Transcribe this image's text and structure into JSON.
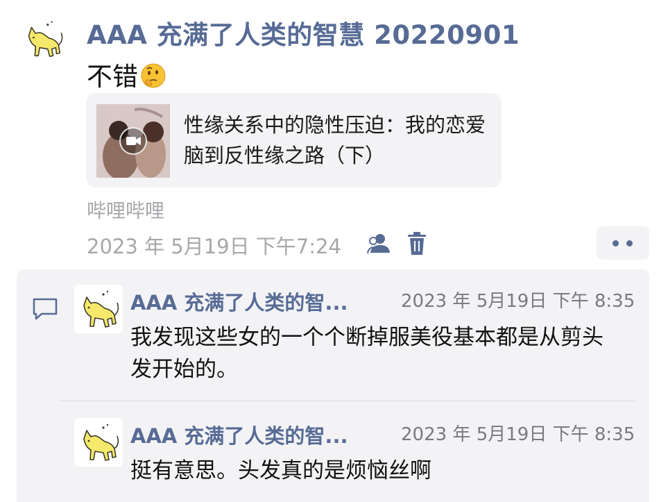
{
  "post": {
    "author": "AAA 充满了人类的智慧 20220901",
    "text": "不错",
    "emoji": "thinking-face",
    "link_card": {
      "title": "性缘关系中的隐性压迫：我的恋爱脑到反性缘之路（下）",
      "thumbnail_icon": "video-camera-icon"
    },
    "source": "哔哩哔哩",
    "time": "2023 年 5月19日 下午7:24"
  },
  "comments": [
    {
      "author": "AAA 充满了人类的智...",
      "time": "2023 年 5月19日 下午 8:35",
      "text": "我发现这些女的一个个断掉服美役基本都是从剪头发开始的。"
    },
    {
      "author": "AAA 充满了人类的智...",
      "time": "2023 年 5月19日 下午 8:35",
      "text": "挺有意思。头发真的是烦恼丝啊"
    }
  ],
  "colors": {
    "name_blue": "#576b95",
    "meta_gray": "#a7a7ab",
    "panel_bg": "#f3f3f5"
  }
}
